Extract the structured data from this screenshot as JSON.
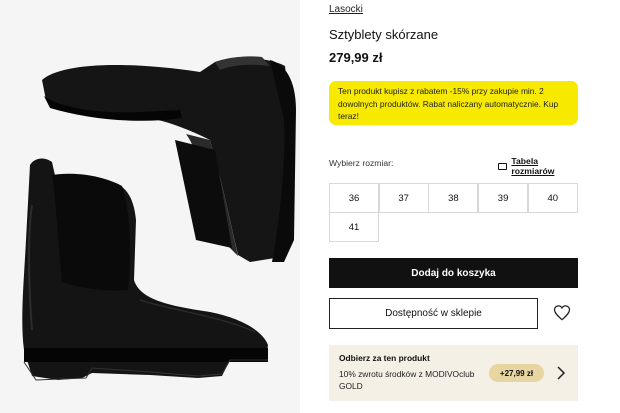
{
  "product": {
    "brand": "Lasocki",
    "title": "Sztyblety skórzane",
    "price": "279,99 zł",
    "image_alt": "boots-image"
  },
  "promo": {
    "text": "Ten produkt kupisz z rabatem -15% przy zakupie min. 2 dowolnych produktów. Rabat naliczany automatycznie. Kup teraz!",
    "color": "#f7ea00"
  },
  "sizes": {
    "label": "Wybierz rozmiar:",
    "table_link": "Tabela rozmiarów",
    "options": [
      "36",
      "37",
      "38",
      "39",
      "40",
      "41"
    ]
  },
  "actions": {
    "add_to_cart": "Dodaj do koszyka",
    "store_availability": "Dostępność w sklepie",
    "wishlist_icon": "heart-icon"
  },
  "reward": {
    "title": "Odbierz za ten produkt",
    "text": "10% zwrotu środków z MODIVOclub GOLD",
    "badge": "+27,99 zł",
    "arrow_icon": "chevron-right-icon"
  }
}
